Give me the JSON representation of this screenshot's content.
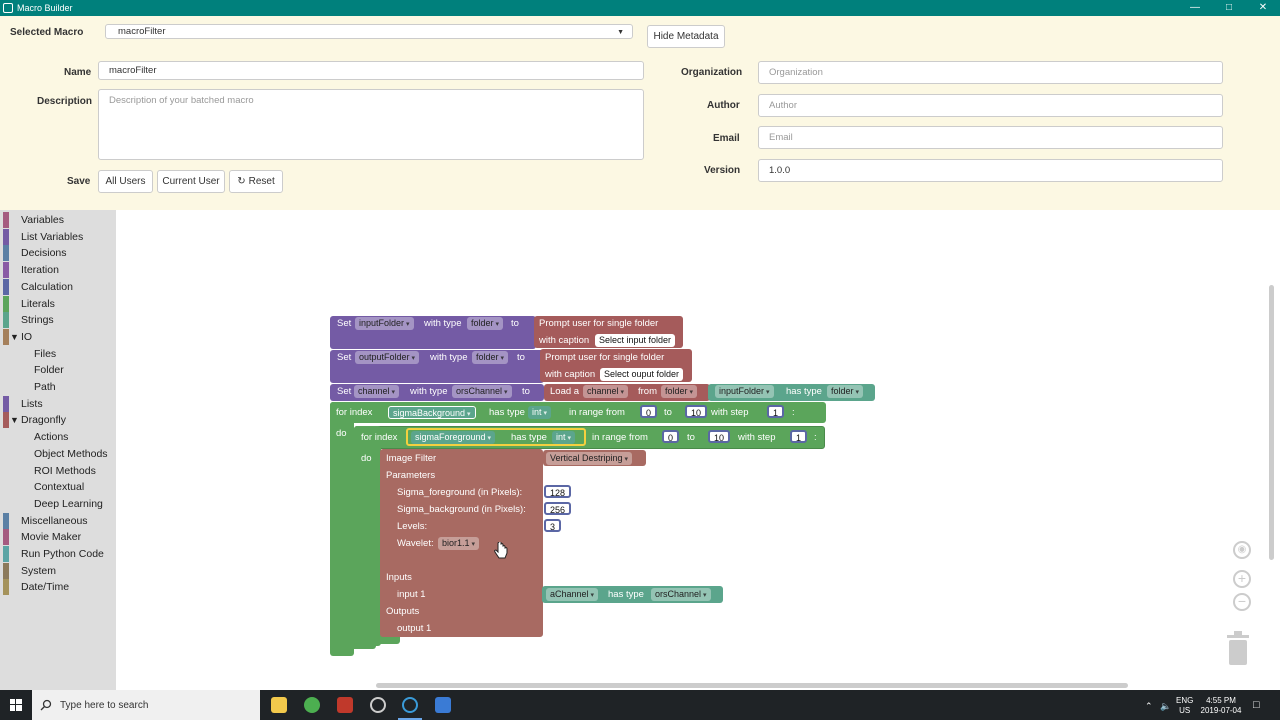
{
  "window": {
    "title": "Macro Builder",
    "controls": [
      "—",
      "□",
      "✕"
    ]
  },
  "meta": {
    "selected_macro_label": "Selected Macro",
    "selected_macro_value": "macroFilter",
    "hide_metadata": "Hide Metadata",
    "name_label": "Name",
    "name_value": "macroFilter",
    "description_label": "Description",
    "description_placeholder": "Description of your batched macro",
    "organization_label": "Organization",
    "organization_placeholder": "Organization",
    "author_label": "Author",
    "author_placeholder": "Author",
    "email_label": "Email",
    "email_placeholder": "Email",
    "version_label": "Version",
    "version_value": "1.0.0",
    "save_label": "Save",
    "all_users": "All Users",
    "current_user": "Current User",
    "reset": "Reset",
    "reset_icon": "↻"
  },
  "toolbox": [
    {
      "label": "Variables",
      "color": "#a55b80",
      "indent": 0
    },
    {
      "label": "List Variables",
      "color": "#745ba5",
      "indent": 0
    },
    {
      "label": "Decisions",
      "color": "#5b80a5",
      "indent": 0
    },
    {
      "label": "Iteration",
      "color": "#8a5ba5",
      "indent": 0
    },
    {
      "label": "Calculation",
      "color": "#5b67a5",
      "indent": 0
    },
    {
      "label": "Literals",
      "color": "#5ba55b",
      "indent": 0
    },
    {
      "label": "Strings",
      "color": "#5ba58c",
      "indent": 0
    },
    {
      "label": "IO",
      "color": "#a5805b",
      "indent": 0,
      "expanded": true
    },
    {
      "label": "Files",
      "color": "",
      "indent": 1
    },
    {
      "label": "Folder",
      "color": "",
      "indent": 1
    },
    {
      "label": "Path",
      "color": "",
      "indent": 1
    },
    {
      "label": "Lists",
      "color": "#745ba5",
      "indent": 0
    },
    {
      "label": "Dragonfly",
      "color": "#a55b5b",
      "indent": 0,
      "expanded": true
    },
    {
      "label": "Actions",
      "color": "",
      "indent": 1
    },
    {
      "label": "Object Methods",
      "color": "",
      "indent": 1
    },
    {
      "label": "ROI Methods",
      "color": "",
      "indent": 1
    },
    {
      "label": "Contextual",
      "color": "",
      "indent": 1
    },
    {
      "label": "Deep Learning",
      "color": "",
      "indent": 1
    },
    {
      "label": "Miscellaneous",
      "color": "#5b80a5",
      "indent": 0
    },
    {
      "label": "Movie Maker",
      "color": "#a55b80",
      "indent": 0
    },
    {
      "label": "Run Python Code",
      "color": "#5ba5a5",
      "indent": 0
    },
    {
      "label": "System",
      "color": "#8c7a5b",
      "indent": 0
    },
    {
      "label": "Date/Time",
      "color": "#a5935b",
      "indent": 0
    }
  ],
  "colors": {
    "purple": "#745ba5",
    "red": "#a55b5b",
    "green": "#5ba55b",
    "teal": "#5ba58c",
    "filter": "#a86a62",
    "num": "#5b67a5"
  },
  "blocks": {
    "set": "Set",
    "with_type": "with type",
    "to": "to",
    "var1": "inputFolder",
    "type1": "folder",
    "prompt": "Prompt user for single folder",
    "with_caption": "with caption",
    "caption1": "Select input folder",
    "var2": "outputFolder",
    "type2": "folder",
    "caption2": "Select ouput folder",
    "var3": "channel",
    "type3": "orsChannel",
    "load_a": "Load a",
    "load_type": "channel",
    "from": "from",
    "from_type": "folder",
    "from_var": "inputFolder",
    "has_type": "has type",
    "from_var_type": "folder",
    "for_index": "for index",
    "loop1_var": "sigmaBackground",
    "int": "int",
    "in_range_from": "in range from",
    "l1_from": "0",
    "l1_to": "10",
    "with_step": "with step",
    "l1_step": "1",
    "colon": ":",
    "do": "do",
    "loop2_var": "sigmaForeground",
    "l2_from": "0",
    "l2_to": "10",
    "l2_step": "1",
    "image_filter": "Image Filter",
    "filter_name": "Vertical Destriping",
    "parameters": "Parameters",
    "p1": "Sigma_foreground (in Pixels):",
    "p1v": "128",
    "p2": "Sigma_background (in Pixels):",
    "p2v": "256",
    "p3": "Levels:",
    "p3v": "3",
    "p4": "Wavelet:",
    "p4v": "bior1.1",
    "inputs": "Inputs",
    "input1": "input 1",
    "in_var": "aChannel",
    "in_type": "orsChannel",
    "outputs": "Outputs",
    "output1": "output 1"
  },
  "taskbar": {
    "search": "Type here to search",
    "lang1": "ENG",
    "lang2": "US",
    "time": "4:55 PM",
    "date": "2019-07-04"
  }
}
